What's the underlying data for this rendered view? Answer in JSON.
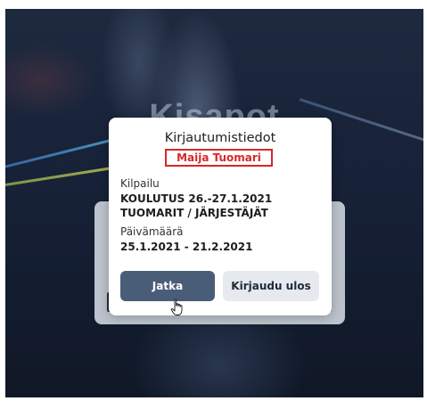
{
  "background": {
    "heading": "Kisapot",
    "accent": "#1a263b"
  },
  "modal": {
    "title": "Kirjautumistiedot",
    "user": "Maija Tuomari",
    "competition_label": "Kilpailu",
    "competition_line1": "KOULUTUS 26.-27.1.2021",
    "competition_line2": "TUOMARIT / JÄRJESTÄJÄT",
    "date_label": "Päivämäärä",
    "date_value": "25.1.2021 - 21.2.2021",
    "continue_label": "Jatka",
    "logout_label": "Kirjaudu ulos",
    "colors": {
      "primary_button": "#4a5d78",
      "secondary_button": "#e6e9ee",
      "user_badge": "#d62828"
    }
  },
  "cursor": {
    "icon": "hand-pointer-icon"
  }
}
